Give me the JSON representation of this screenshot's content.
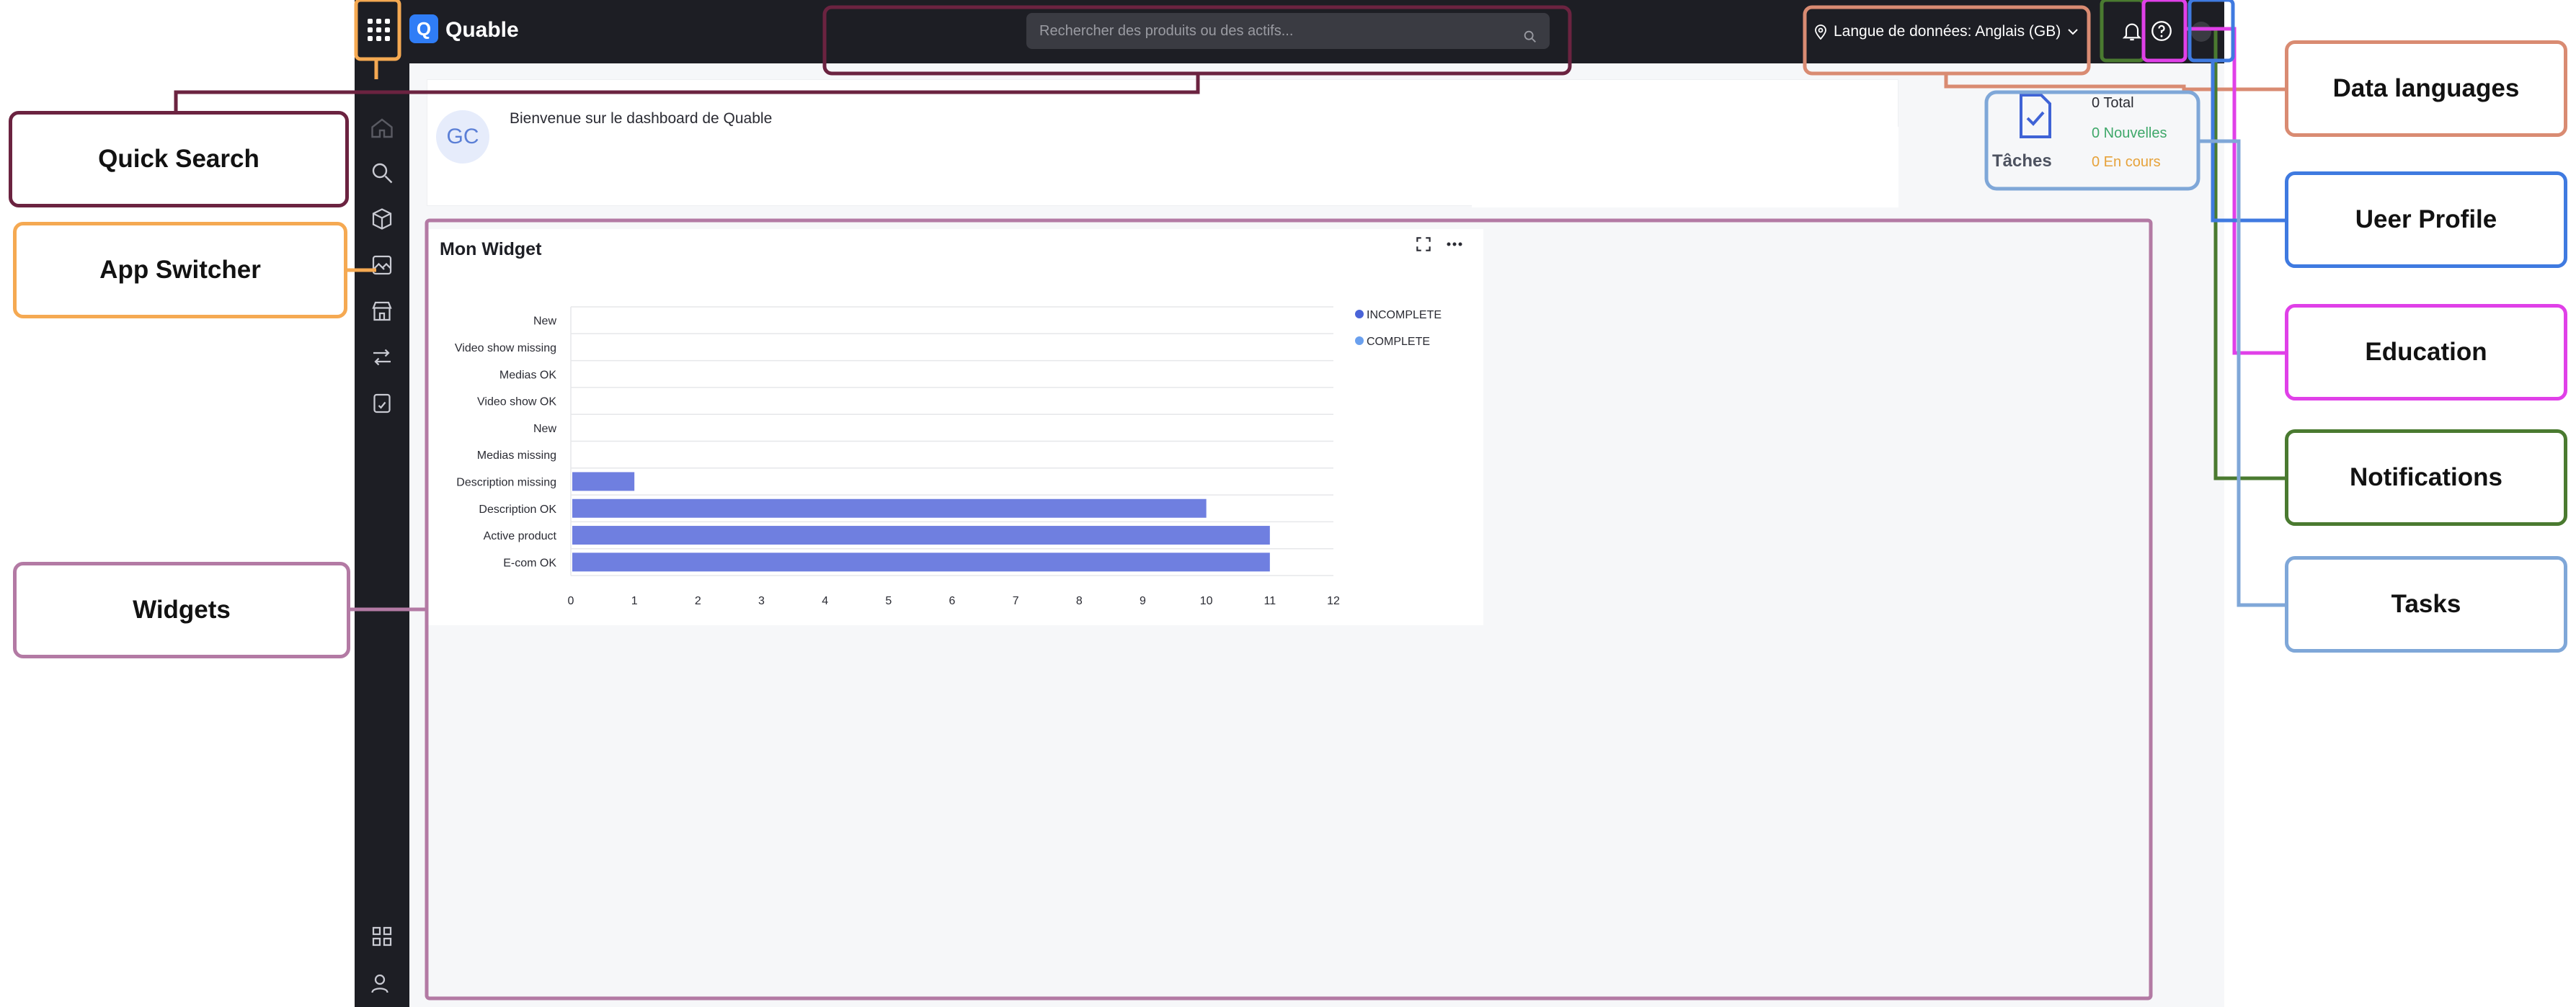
{
  "app": {
    "logo_text": "Quable",
    "logo_mark": "Q",
    "search_placeholder": "Rechercher des produits ou des actifs...",
    "language_label": "Langue de données: Anglais (GB)"
  },
  "welcome": {
    "initials": "GC",
    "text": "Bienvenue sur le dashboard de Quable"
  },
  "tasks": {
    "title": "Tâches",
    "total": "0 Total",
    "new": "0 Nouvelles",
    "in_progress": "0 En cours"
  },
  "widget": {
    "title": "Mon Widget"
  },
  "callouts": {
    "quick_search": "Quick Search",
    "app_switcher": "App Switcher",
    "widgets": "Widgets",
    "data_languages": "Data languages",
    "user_profile": "Ueer Profile",
    "education": "Education",
    "notifications": "Notifications",
    "tasks": "Tasks"
  },
  "colors": {
    "bar": "#6f7fe0",
    "legend_incomplete": "#4a64d8",
    "legend_complete": "#6aa0ee",
    "topbar": "#1d1e24"
  },
  "chart_data": {
    "type": "bar",
    "orientation": "horizontal",
    "categories": [
      "New",
      "Video show missing",
      "Medias OK",
      "Video show OK",
      "New",
      "Medias missing",
      "Description missing",
      "Description OK",
      "Active product",
      "E-com OK"
    ],
    "series": [
      {
        "name": "INCOMPLETE",
        "values": [
          0,
          0,
          0,
          0,
          0,
          0,
          1,
          10,
          11,
          11
        ]
      },
      {
        "name": "COMPLETE",
        "values": [
          0,
          0,
          0,
          0,
          0,
          0,
          0,
          0,
          0,
          0
        ]
      }
    ],
    "xticks": [
      "0",
      "1",
      "2",
      "3",
      "4",
      "5",
      "6",
      "7",
      "8",
      "9",
      "10",
      "11",
      "12"
    ],
    "xlim": [
      0,
      12
    ],
    "legend": "top-right",
    "grid": true
  }
}
